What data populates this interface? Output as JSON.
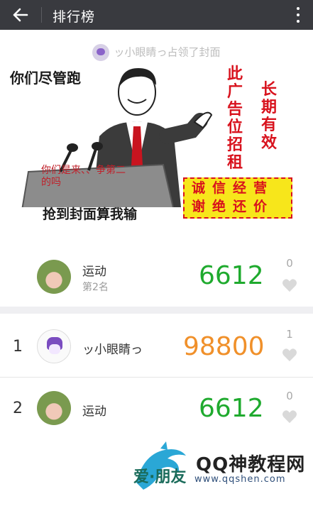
{
  "topbar": {
    "title": "排行榜"
  },
  "cover": {
    "claim_text": "ッ小眼睛っ占领了封面",
    "meme_left": "你们尽管跑",
    "meme_podium": "你们是来、、争第二的吗",
    "meme_bottom": "抢到封面算我输",
    "ad_col1": "此广告位招租",
    "ad_col2": "长期有效",
    "ad_line1": "诚信经营",
    "ad_line2": "谢绝还价"
  },
  "featured": {
    "name": "运动",
    "rank_text": "第2名",
    "score": "6612",
    "likes": "0"
  },
  "rows": [
    {
      "rank": "1",
      "name": "ッ小眼睛っ",
      "score": "98800",
      "likes": "1"
    },
    {
      "rank": "2",
      "name": "运动",
      "score": "6612",
      "likes": "0"
    }
  ],
  "watermark": {
    "title": "QQ神教程网",
    "url": "www.qqshen.com",
    "friends": "爱·朋友"
  },
  "colors": {
    "green": "#1faa2e",
    "orange": "#f0902a",
    "topbar": "#393a3f"
  }
}
